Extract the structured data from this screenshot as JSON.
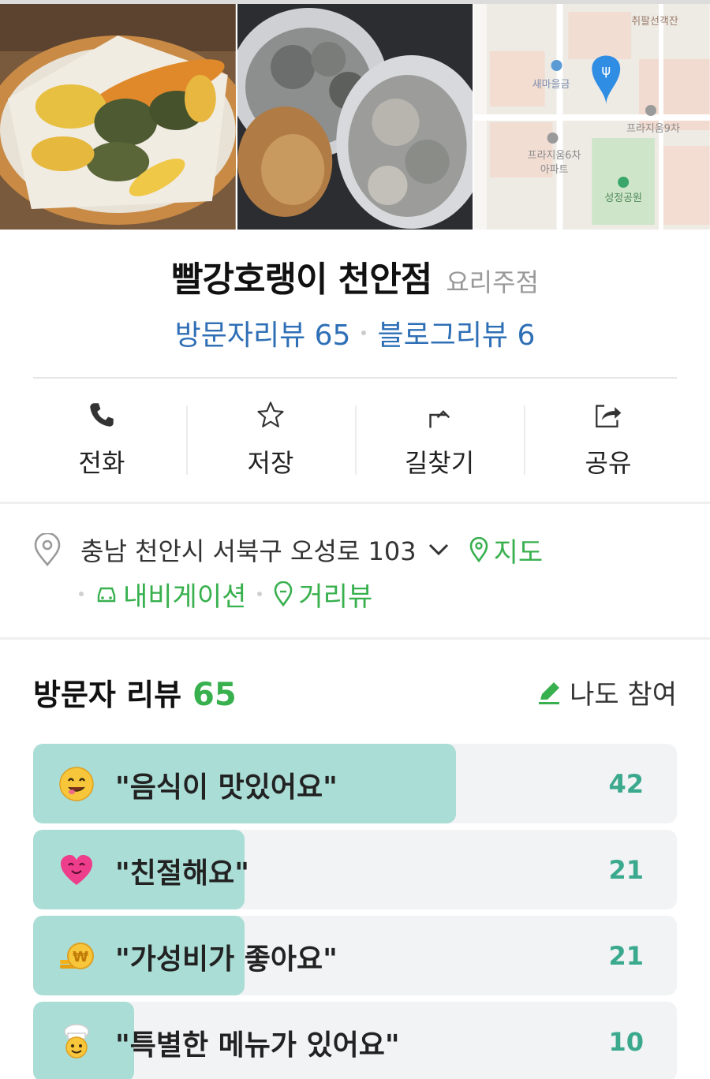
{
  "place": {
    "name": "빨강호랭이 천안점",
    "category": "요리주점",
    "visitor_review_link": "방문자리뷰 65",
    "blog_review_link": "블로그리뷰 6"
  },
  "actions": [
    {
      "label": "전화",
      "icon": "phone-icon"
    },
    {
      "label": "저장",
      "icon": "star-icon"
    },
    {
      "label": "길찾기",
      "icon": "directions-icon"
    },
    {
      "label": "공유",
      "icon": "share-icon"
    }
  ],
  "address": {
    "text": "충남 천안시 서북구 오성로 103",
    "map_link": "지도",
    "navigation_link": "내비게이션",
    "street_view_link": "거리뷰"
  },
  "map_labels": {
    "top": "취팔선객잔",
    "left": "새마을금",
    "right": "프라지움9차",
    "mid_line1": "프라지움6차",
    "mid_line2": "아파트",
    "park": "성정공원"
  },
  "visitor_reviews": {
    "title": "방문자 리뷰",
    "count": "65",
    "join_label": "나도 참여",
    "items": [
      {
        "text": "\"음식이 맛있어요\"",
        "count": "42",
        "ratio": 0.657,
        "emoji": "yummy-face-icon"
      },
      {
        "text": "\"친절해요\"",
        "count": "21",
        "ratio": 0.328,
        "emoji": "heart-face-icon"
      },
      {
        "text": "\"가성비가 좋아요\"",
        "count": "21",
        "ratio": 0.328,
        "emoji": "coin-icon"
      },
      {
        "text": "\"특별한 메뉴가 있어요\"",
        "count": "10",
        "ratio": 0.157,
        "emoji": "chef-icon"
      }
    ]
  },
  "colors": {
    "link_blue": "#2f6fb6",
    "accent_green": "#38b04e",
    "bar_fill": "#a9ddd5",
    "bar_count": "#3aa98d"
  }
}
